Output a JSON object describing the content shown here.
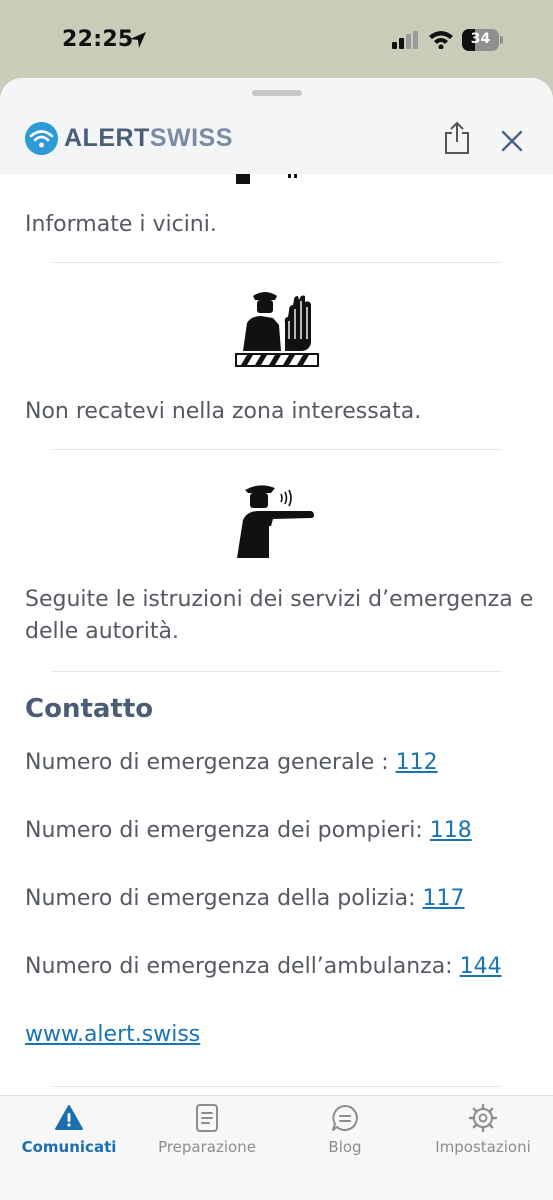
{
  "status_bar": {
    "time": "22:25",
    "battery": "34"
  },
  "header": {
    "logo_alert": "ALERT",
    "logo_swiss": "SWISS"
  },
  "content": {
    "instructions": [
      "Informate i vicini.",
      "Non recatevi nella zona interessata.",
      "Seguite le istruzioni dei servizi d’emergenza e delle autorità."
    ],
    "contact_heading": "Contatto",
    "contacts": [
      {
        "label": "Numero di emergenza generale : ",
        "number": "112"
      },
      {
        "label": "Numero di emergenza dei pompieri: ",
        "number": "118"
      },
      {
        "label": "Numero di emergenza della polizia: ",
        "number": "117"
      },
      {
        "label": "Numero di emergenza dell’ambulanza: ",
        "number": "144"
      }
    ],
    "website": "www.alert.swiss"
  },
  "tabs": [
    {
      "label": "Comunicati",
      "icon": "warning-icon",
      "active": true
    },
    {
      "label": "Preparazione",
      "icon": "checklist-icon",
      "active": false
    },
    {
      "label": "Blog",
      "icon": "chat-icon",
      "active": false
    },
    {
      "label": "Impostazioni",
      "icon": "gear-icon",
      "active": false
    }
  ],
  "colors": {
    "accent": "#1b6fb0",
    "heading": "#4b5d75",
    "text": "#555a62",
    "link": "#1a73b3"
  }
}
